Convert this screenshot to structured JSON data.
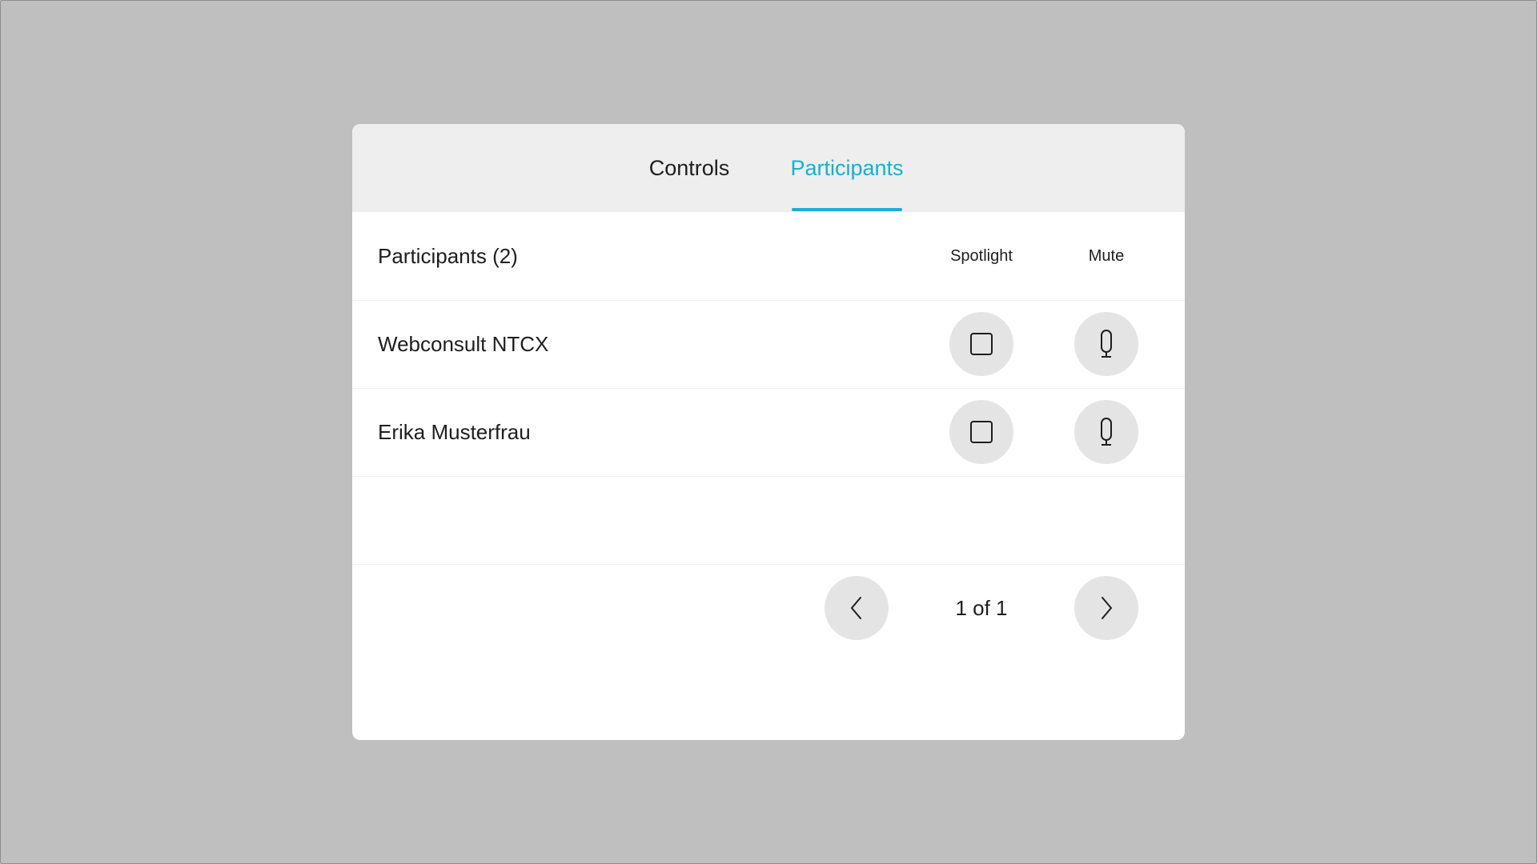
{
  "tabs": [
    {
      "label": "Controls",
      "active": false
    },
    {
      "label": "Participants",
      "active": true
    }
  ],
  "participants": {
    "header_label": "Participants (2)",
    "columns": {
      "spotlight": "Spotlight",
      "mute": "Mute"
    },
    "rows": [
      {
        "name": "Webconsult NTCX",
        "spotlight_icon": "square-icon",
        "mute_icon": "microphone-icon"
      },
      {
        "name": "Erika Musterfrau",
        "spotlight_icon": "square-icon",
        "mute_icon": "microphone-icon"
      }
    ]
  },
  "pagination": {
    "text": "1 of 1",
    "prev_icon": "chevron-left-icon",
    "next_icon": "chevron-right-icon"
  },
  "colors": {
    "accent": "#1ab0cf",
    "backdrop": "#bfbfbf",
    "tabbar": "#eeeeee",
    "button": "#e4e4e4"
  }
}
